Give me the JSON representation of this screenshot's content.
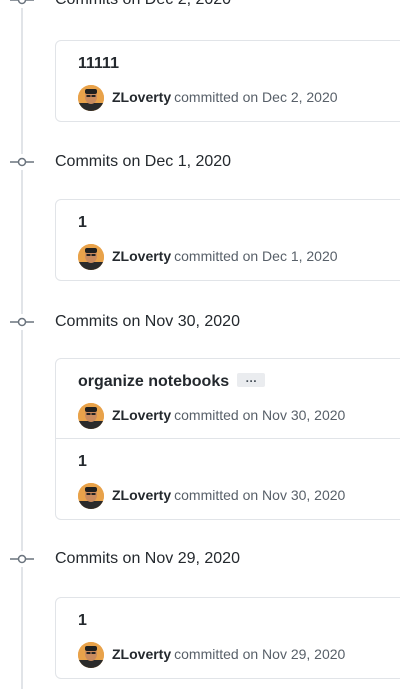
{
  "groups": [
    {
      "title": "Commits on Dec 2, 2020",
      "commits": [
        {
          "message": "11111",
          "author": "ZLoverty",
          "meta": "committed on Dec 2, 2020"
        }
      ]
    },
    {
      "title": "Commits on Dec 1, 2020",
      "commits": [
        {
          "message": "1",
          "author": "ZLoverty",
          "meta": "committed on Dec 1, 2020"
        }
      ]
    },
    {
      "title": "Commits on Nov 30, 2020",
      "commits": [
        {
          "message": "organize notebooks",
          "ellipsis": "…",
          "author": "ZLoverty",
          "meta": "committed on Nov 30, 2020"
        },
        {
          "message": "1",
          "author": "ZLoverty",
          "meta": "committed on Nov 30, 2020"
        }
      ]
    },
    {
      "title": "Commits on Nov 29, 2020",
      "commits": [
        {
          "message": "1",
          "author": "ZLoverty",
          "meta": "committed on Nov 29, 2020"
        }
      ]
    }
  ],
  "icons": {
    "node": "git-commit-icon",
    "avatar": "user-avatar"
  }
}
